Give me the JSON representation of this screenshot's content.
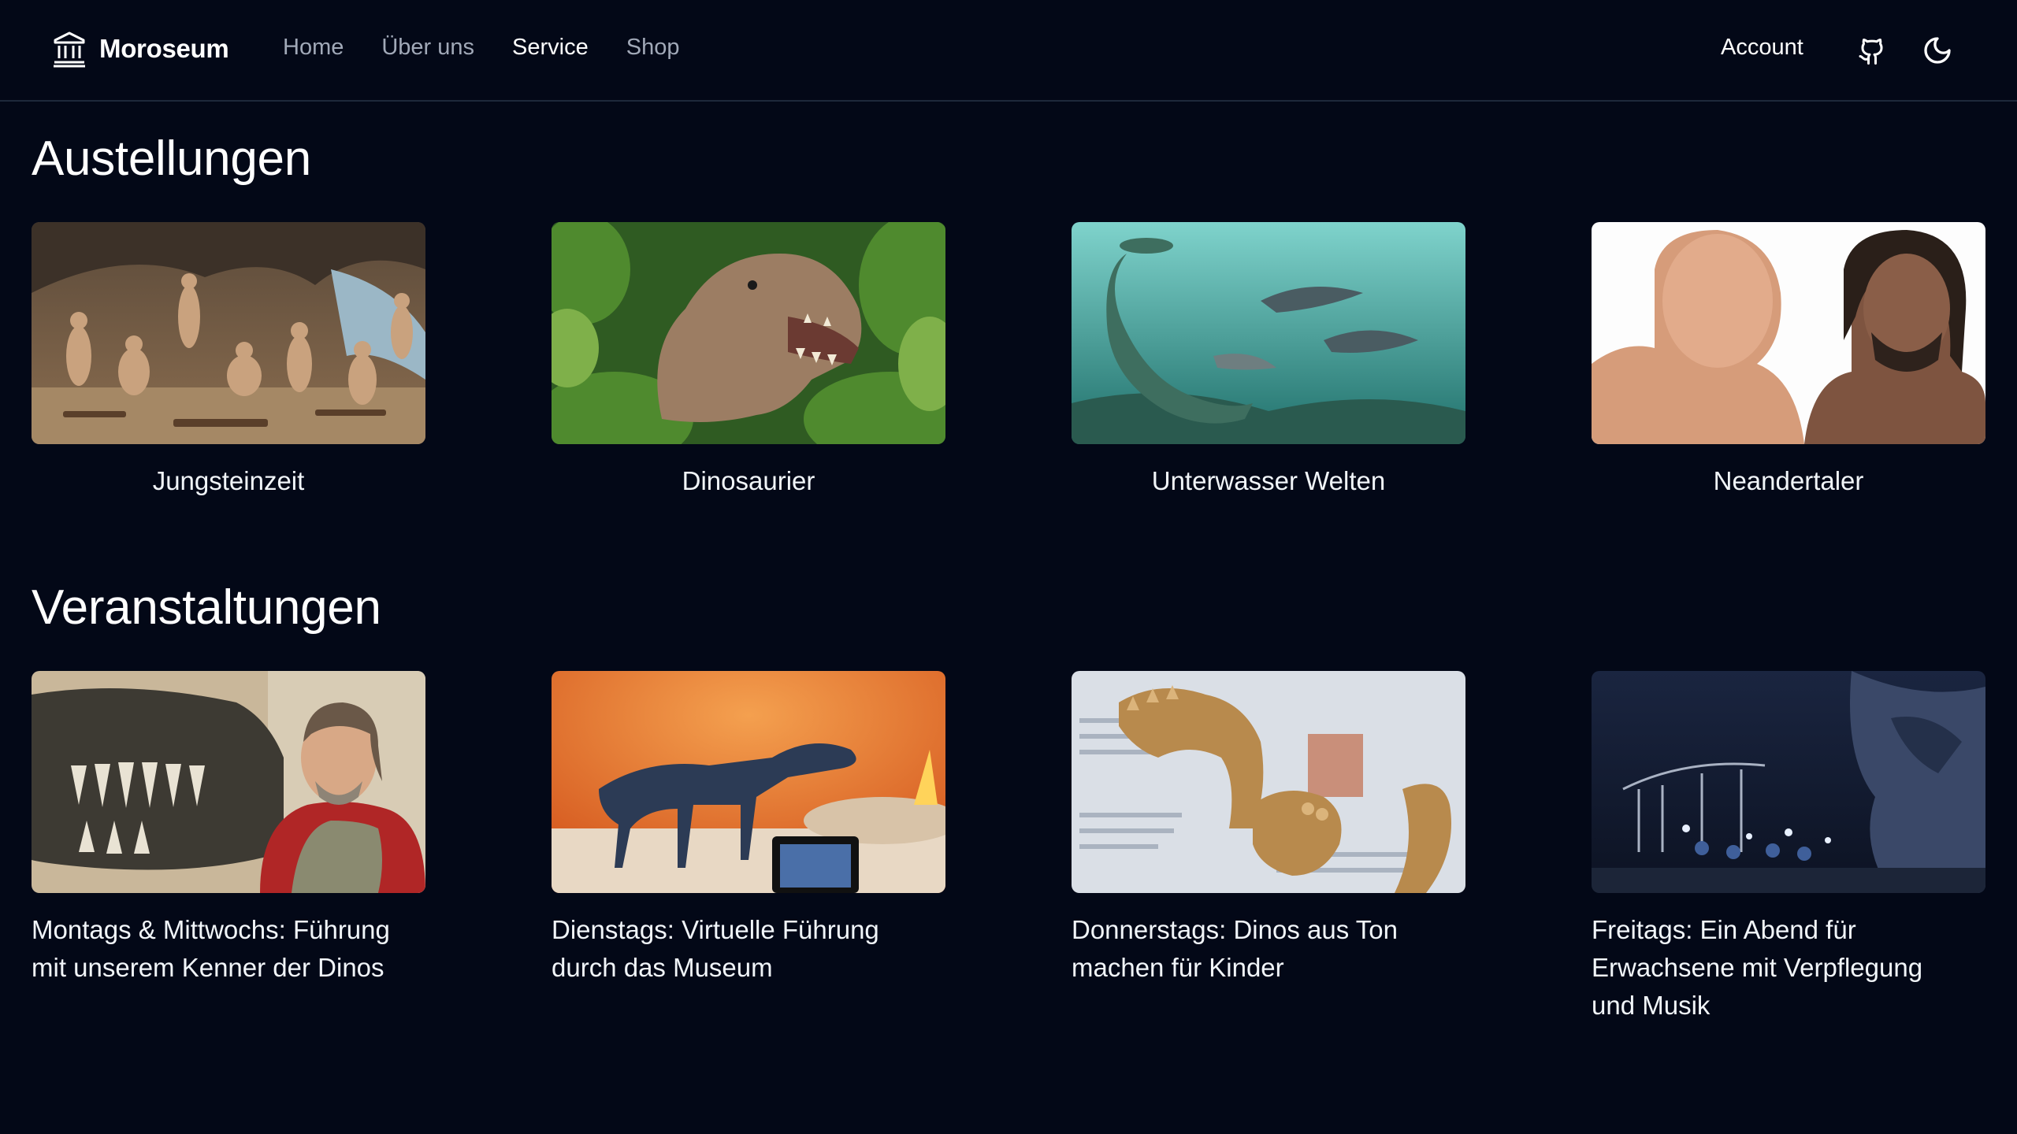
{
  "header": {
    "brand": "Moroseum",
    "brand_icon": "museum-icon",
    "nav": [
      "Home",
      "Über uns",
      "Service",
      "Shop"
    ],
    "active_nav": "Service",
    "account": "Account",
    "github_icon": "github-icon",
    "theme_icon": "moon-icon"
  },
  "exhibitions": {
    "title": "Austellungen",
    "items": [
      {
        "label": "Jungsteinzeit"
      },
      {
        "label": "Dinosaurier"
      },
      {
        "label": "Unterwasser Welten"
      },
      {
        "label": "Neandertaler"
      }
    ]
  },
  "events": {
    "title": "Veranstaltungen",
    "items": [
      {
        "label": "Montags & Mittwochs: Führung mit unserem Kenner der Dinos"
      },
      {
        "label": "Dienstags: Virtuelle Führung durch das Museum"
      },
      {
        "label": "Donnerstags: Dinos aus Ton machen für Kinder"
      },
      {
        "label": "Freitags: Ein Abend für Erwachsene mit Verpflegung und Musik"
      }
    ]
  },
  "colors": {
    "background": "#030817",
    "text": "#ffffff",
    "muted_nav": "#a1a9b8",
    "divider": "#1e293b"
  }
}
